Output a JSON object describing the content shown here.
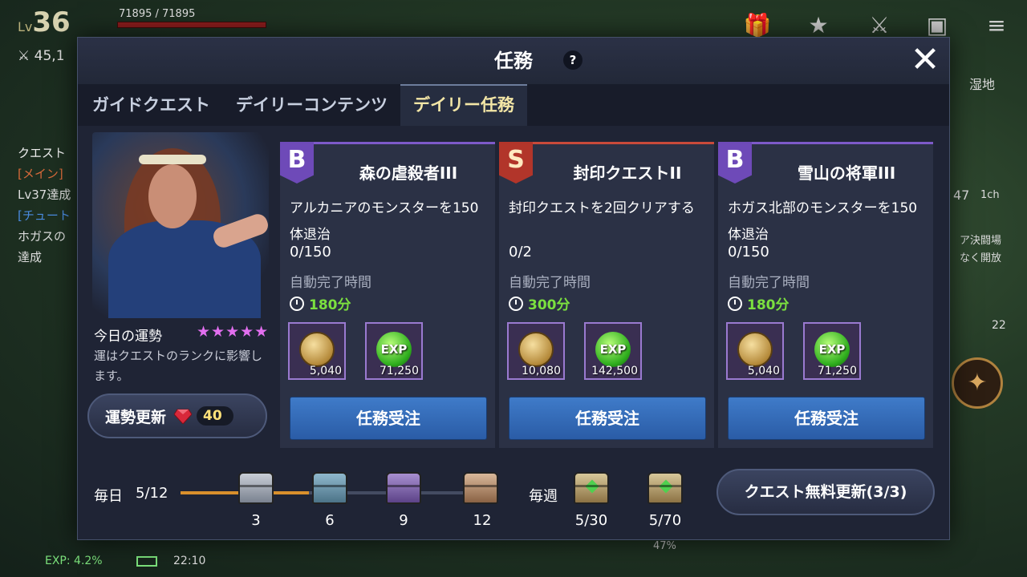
{
  "hud": {
    "level_prefix": "Lv",
    "level": "36",
    "hp": "71895 / 71895",
    "power": "45,1",
    "quest_heading": "クエスト",
    "quest_main": "[メイン]",
    "quest_main_detail": "Lv37達成",
    "quest_tutorial": "[チュート",
    "quest_tutorial_detail": "ホガスの",
    "quest_tutorial_detail2": "達成",
    "exp": "EXP: 4.2%",
    "time": "22:10",
    "right_text": "湿地",
    "right_mid1": "47",
    "right_mid2": "1ch",
    "right_side1": "ア決闘場",
    "right_side2": "なく開放",
    "right_count": "22",
    "bottom_pct": "47%"
  },
  "modal": {
    "title": "任務",
    "help_icon": "?",
    "close_icon": "✕"
  },
  "tabs": [
    {
      "label": "ガイドクエスト"
    },
    {
      "label": "デイリーコンテンツ"
    },
    {
      "label": "デイリー任務"
    }
  ],
  "fortune": {
    "label": "今日の運勢",
    "stars": "★★★★★",
    "description": "運はクエストのランクに影響します。",
    "button_label": "運勢更新",
    "button_cost": "40"
  },
  "quests": [
    {
      "rank": "B",
      "title": "森の虐殺者III",
      "description": "アルカニアのモンスターを150体退治",
      "progress": "0/150",
      "auto_label": "自動完了時間",
      "auto_time": "180分",
      "rewards": [
        {
          "type": "coin",
          "qty": "5,040"
        },
        {
          "type": "exp",
          "label": "EXP",
          "qty": "71,250"
        }
      ],
      "button": "任務受注"
    },
    {
      "rank": "S",
      "title": "封印クエストII",
      "description": "封印クエストを2回クリアする",
      "progress": "0/2",
      "auto_label": "自動完了時間",
      "auto_time": "300分",
      "rewards": [
        {
          "type": "coin",
          "qty": "10,080"
        },
        {
          "type": "exp",
          "label": "EXP",
          "qty": "142,500"
        }
      ],
      "button": "任務受注"
    },
    {
      "rank": "B",
      "title": "雪山の将軍III",
      "description": "ホガス北部のモンスターを150体退治",
      "progress": "0/150",
      "auto_label": "自動完了時間",
      "auto_time": "180分",
      "rewards": [
        {
          "type": "coin",
          "qty": "5,040"
        },
        {
          "type": "exp",
          "label": "EXP",
          "qty": "71,250"
        }
      ],
      "button": "任務受注"
    }
  ],
  "daily": {
    "label": "毎日",
    "count": "5/12",
    "progress_fraction": 0.42,
    "milestones": [
      "3",
      "6",
      "9",
      "12"
    ]
  },
  "weekly": {
    "label": "毎週",
    "milestones": [
      "5/30",
      "5/70"
    ]
  },
  "refresh_button": "クエスト無料更新(3/3)",
  "colors": {
    "rank_b": "#6e4ab8",
    "rank_s": "#b2352a",
    "accept_button": "#3f7bc9",
    "auto_time": "#7be03f",
    "stars": "#e36ff0",
    "active_tab": "#f3e6a6"
  }
}
